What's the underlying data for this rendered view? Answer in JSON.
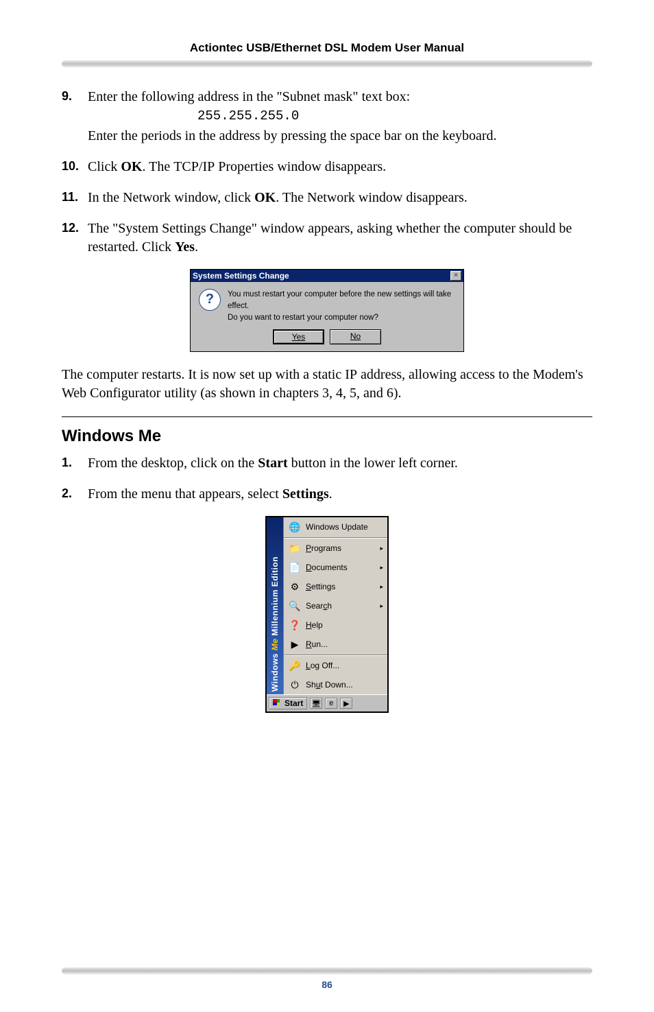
{
  "header": {
    "title": "Actiontec USB/Ethernet DSL Modem User Manual"
  },
  "footer": {
    "page_number": "86"
  },
  "steps_a": {
    "9": {
      "num": "9.",
      "text_a": "Enter the following address in the \"Subnet mask\" text box:",
      "code": "255.255.255.0",
      "text_b": "Enter the periods in the address by pressing the space bar on the keyboard."
    },
    "10": {
      "num": "10.",
      "text_a": "Click ",
      "bold_a": "OK",
      "text_b": ". The ",
      "sc_a": "TCP/IP",
      "text_c": " Properties window disappears."
    },
    "11": {
      "num": "11.",
      "text_a": "In the Network window, click ",
      "bold_a": "OK",
      "text_b": ". The Network window disappears."
    },
    "12": {
      "num": "12.",
      "text_a": "The \"System Settings Change\" window appears, asking whether the computer should be restarted. Click ",
      "bold_a": "Yes",
      "text_b": "."
    }
  },
  "dialog": {
    "title": "System Settings Change",
    "line1": "You must restart your computer before the new settings will take effect.",
    "line2": "Do you want to restart your computer now?",
    "yes": "Yes",
    "no": "No",
    "close_glyph": "×",
    "icon_glyph": "?"
  },
  "para_after": {
    "text_a": "The computer restarts. It is now set up with a static ",
    "sc_a": "IP",
    "text_b": " address, allowing access to the Modem's Web Configurator utility (as shown in chapters 3, 4, 5, and 6)."
  },
  "section_heading": "Windows Me",
  "steps_b": {
    "1": {
      "num": "1.",
      "text_a": "From the desktop, click on the ",
      "bold_a": "Start",
      "text_b": " button in the lower left corner."
    },
    "2": {
      "num": "2.",
      "text_a": "From the menu that appears, select ",
      "bold_a": "Settings",
      "text_b": "."
    }
  },
  "startmenu": {
    "banner_a": "Windows",
    "banner_b": "Me",
    "banner_c": " Millennium Edition",
    "items": [
      {
        "icon": "🌐",
        "label": "Windows Update",
        "arrow": false,
        "name": "windows-update"
      },
      {
        "sep": true
      },
      {
        "icon": "📁",
        "label": "Programs",
        "arrow": true,
        "name": "programs",
        "ul": "P"
      },
      {
        "icon": "📄",
        "label": "Documents",
        "arrow": true,
        "name": "documents",
        "ul": "D"
      },
      {
        "icon": "⚙",
        "label": "Settings",
        "arrow": true,
        "name": "settings",
        "ul": "S"
      },
      {
        "icon": "🔍",
        "label": "Search",
        "arrow": true,
        "name": "search",
        "ul": "c",
        "pre": "Sear"
      },
      {
        "icon": "❓",
        "label": "Help",
        "arrow": false,
        "name": "help",
        "ul": "H"
      },
      {
        "icon": "▶",
        "label": "Run...",
        "arrow": false,
        "name": "run",
        "ul": "R"
      },
      {
        "sep": true
      },
      {
        "icon": "🔑",
        "label": "Log Off...",
        "arrow": false,
        "name": "logoff",
        "ul": "L"
      },
      {
        "icon": "⏻",
        "label": "Shut Down...",
        "arrow": false,
        "name": "shutdown",
        "ul": "u",
        "pre": "Sh"
      }
    ],
    "start_label": "Start",
    "arrow_glyph": "▸"
  }
}
